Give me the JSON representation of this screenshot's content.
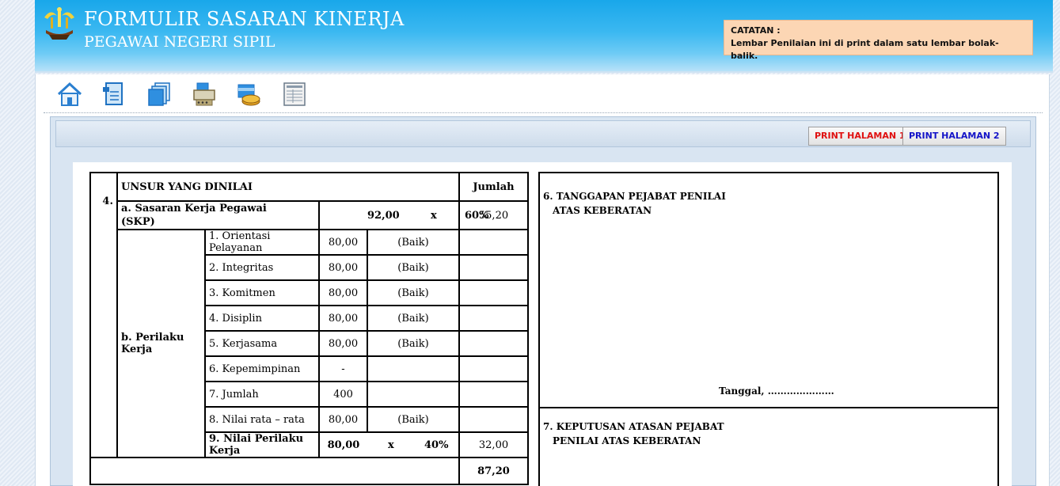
{
  "header": {
    "title": "FORMULIR SASARAN KINERJA",
    "subtitle": "PEGAWAI NEGERI SIPIL"
  },
  "catatan": {
    "label": "CATATAN :",
    "text": "Lembar Penilaian ini di print dalam satu lembar bolak-balik."
  },
  "toolbar": {
    "icons": [
      "home-icon",
      "document-icon",
      "pages-icon",
      "printer-icon",
      "folder-coins-icon",
      "report-icon"
    ]
  },
  "buttons": {
    "print1": "PRINT HALAMAN 1",
    "print2": "PRINT HALAMAN 2"
  },
  "left_table": {
    "number": "4.",
    "header_title": "UNSUR YANG DINILAI",
    "header_jumlah": "Jumlah",
    "skp": {
      "label_line1": "a. Sasaran Kerja Pegawai",
      "label_line2": "(SKP)",
      "value": "92,00",
      "x": "x",
      "percent": "60%",
      "jumlah": "55,20"
    },
    "perilaku_label": "b. Perilaku Kerja",
    "perilaku_rows": [
      {
        "name": "1. Orientasi Pelayanan",
        "value": "80,00",
        "grade": "(Baik)"
      },
      {
        "name": "2. Integritas",
        "value": "80,00",
        "grade": "(Baik)"
      },
      {
        "name": "3. Komitmen",
        "value": "80,00",
        "grade": "(Baik)"
      },
      {
        "name": "4. Disiplin",
        "value": "80,00",
        "grade": "(Baik)"
      },
      {
        "name": "5. Kerjasama",
        "value": "80,00",
        "grade": "(Baik)"
      },
      {
        "name": "6. Kepemimpinan",
        "value": "-",
        "grade": ""
      },
      {
        "name": "7. Jumlah",
        "value": "400",
        "grade": ""
      },
      {
        "name": "8. Nilai rata – rata",
        "value": "80,00",
        "grade": "(Baik)"
      }
    ],
    "nilai_perilaku": {
      "label": "9. Nilai Perilaku Kerja",
      "value": "80,00",
      "x": "x",
      "percent": "40%",
      "jumlah": "32,00"
    },
    "total": "87,20"
  },
  "right_table": {
    "section6_line1": "6. TANGGAPAN PEJABAT PENILAI",
    "section6_line2": "ATAS KEBERATAN",
    "tanggal": "Tanggal, …………………",
    "section7_line1": "7. KEPUTUSAN ATASAN PEJABAT",
    "section7_line2": "PENILAI ATAS KEBERATAN"
  }
}
